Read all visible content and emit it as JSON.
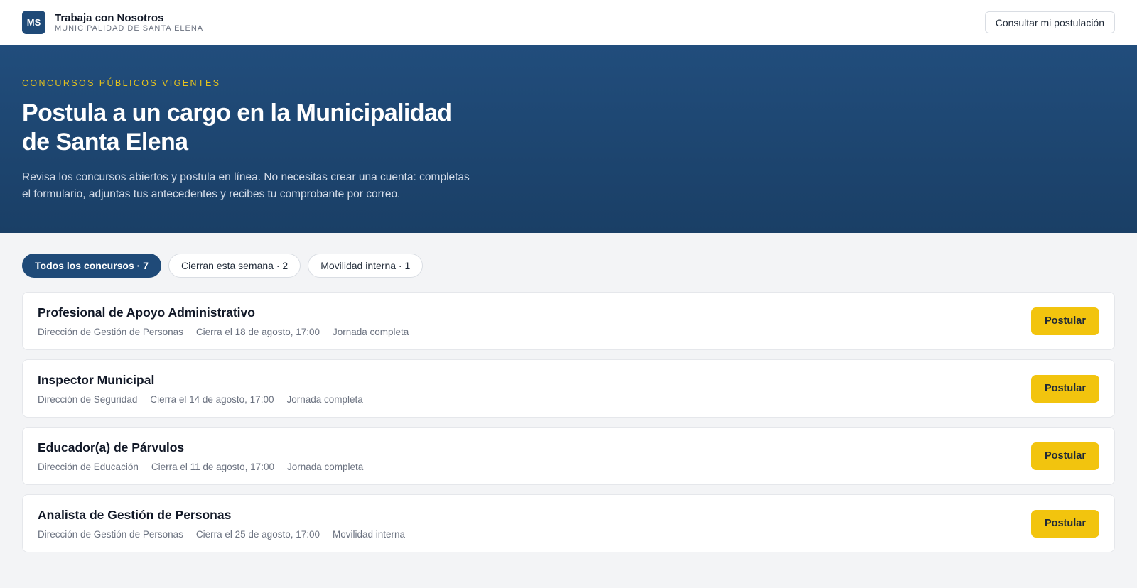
{
  "header": {
    "logo_text": "MS",
    "title": "Trabaja con Nosotros",
    "subtitle": "MUNICIPALIDAD DE SANTA ELENA",
    "consult_label": "Consultar mi postulación"
  },
  "hero": {
    "eyebrow": "CONCURSOS PÚBLICOS VIGENTES",
    "title": "Postula a un cargo en la Municipalidad de Santa Elena",
    "description": "Revisa los concursos abiertos y postula en línea. No necesitas crear una cuenta: completas el formulario, adjuntas tus antecedentes y recibes tu comprobante por correo."
  },
  "filters": [
    {
      "label": "Todos los concursos · 7",
      "active": true
    },
    {
      "label": "Cierran esta semana · 2",
      "active": false
    },
    {
      "label": "Movilidad interna · 1",
      "active": false
    }
  ],
  "jobs": [
    {
      "title": "Profesional de Apoyo Administrativo",
      "department": "Dirección de Gestión de Personas",
      "closing": "Cierra el 18 de agosto, 17:00",
      "type": "Jornada completa",
      "apply_label": "Postular"
    },
    {
      "title": "Inspector Municipal",
      "department": "Dirección de Seguridad",
      "closing": "Cierra el 14 de agosto, 17:00",
      "type": "Jornada completa",
      "apply_label": "Postular"
    },
    {
      "title": "Educador(a) de Párvulos",
      "department": "Dirección de Educación",
      "closing": "Cierra el 11 de agosto, 17:00",
      "type": "Jornada completa",
      "apply_label": "Postular"
    },
    {
      "title": "Analista de Gestión de Personas",
      "department": "Dirección de Gestión de Personas",
      "closing": "Cierra el 25 de agosto, 17:00",
      "type": "Movilidad interna",
      "apply_label": "Postular"
    }
  ],
  "colors": {
    "brand_navy": "#1f4a78",
    "accent_yellow": "#f2c40e",
    "eyebrow_gold": "#e6c21c"
  }
}
